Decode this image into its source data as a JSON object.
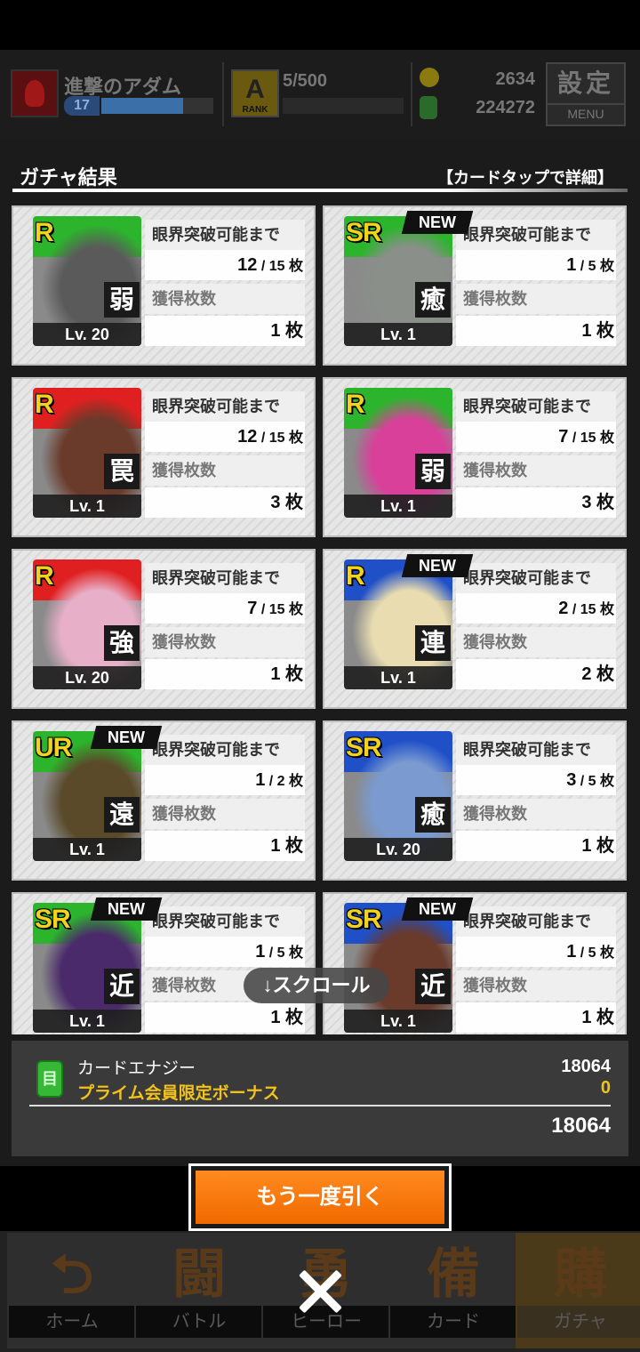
{
  "header": {
    "player_name": "進撃のアダム",
    "level": "17",
    "rank_letter": "A",
    "rank_label": "RANK",
    "stamina": "5/500",
    "coins": "2634",
    "energy": "224272",
    "menu_big": "設定",
    "menu_small": "MENU",
    "xp_fraction": 0.73
  },
  "panel": {
    "title": "ガチャ結果",
    "hint": "【カードタップで詳細】"
  },
  "labels": {
    "limit_break": "眼界突破可能まで",
    "obtained": "獲得枚数",
    "new": "NEW"
  },
  "cards": [
    {
      "rarity": "R",
      "role": "弱",
      "level": "Lv. 20",
      "progress": "12",
      "total": "/ 15 枚",
      "obtained": "1 枚",
      "new": false,
      "bg": "#2cb52c",
      "art": "#5a5a5a"
    },
    {
      "rarity": "SR",
      "role": "癒",
      "level": "Lv. 1",
      "progress": "1",
      "total": "/ 5 枚",
      "obtained": "1 枚",
      "new": true,
      "bg": "#2cb52c",
      "art": "#8a8f8a"
    },
    {
      "rarity": "R",
      "role": "罠",
      "level": "Lv. 1",
      "progress": "12",
      "total": "/ 15 枚",
      "obtained": "3 枚",
      "new": false,
      "bg": "#e02020",
      "art": "#6a3a2a"
    },
    {
      "rarity": "R",
      "role": "弱",
      "level": "Lv. 1",
      "progress": "7",
      "total": "/ 15 枚",
      "obtained": "3 枚",
      "new": false,
      "bg": "#2cb52c",
      "art": "#d8409a"
    },
    {
      "rarity": "R",
      "role": "強",
      "level": "Lv. 20",
      "progress": "7",
      "total": "/ 15 枚",
      "obtained": "1 枚",
      "new": false,
      "bg": "#e02020",
      "art": "#e8b0c8"
    },
    {
      "rarity": "R",
      "role": "連",
      "level": "Lv. 1",
      "progress": "2",
      "total": "/ 15 枚",
      "obtained": "2 枚",
      "new": true,
      "bg": "#2050c8",
      "art": "#e8dcb0"
    },
    {
      "rarity": "UR",
      "role": "遠",
      "level": "Lv. 1",
      "progress": "1",
      "total": "/ 2 枚",
      "obtained": "1 枚",
      "new": true,
      "bg": "#2cb52c",
      "art": "#5a4a2a"
    },
    {
      "rarity": "SR",
      "role": "癒",
      "level": "Lv. 20",
      "progress": "3",
      "total": "/ 5 枚",
      "obtained": "1 枚",
      "new": false,
      "bg": "#2050c8",
      "art": "#7a9ad0"
    },
    {
      "rarity": "SR",
      "role": "近",
      "level": "Lv. 1",
      "progress": "1",
      "total": "/ 5 枚",
      "obtained": "1 枚",
      "new": true,
      "bg": "#2cb52c",
      "art": "#4a2a6a"
    },
    {
      "rarity": "SR",
      "role": "近",
      "level": "Lv. 1",
      "progress": "1",
      "total": "/ 5 枚",
      "obtained": "1 枚",
      "new": true,
      "bg": "#2050c8",
      "art": "#6a3a2a"
    }
  ],
  "scroll_hint": "↓スクロール",
  "energy_summary": {
    "icon_glyph": "目",
    "label": "カードエナジー",
    "bonus_label": "プライム会員限定ボーナス",
    "value": "18064",
    "bonus_value": "0",
    "total": "18064"
  },
  "redraw_label": "もう一度引く",
  "nav": [
    {
      "label": "ホーム",
      "icon": "home-icon",
      "glyph": "⮌",
      "active": false
    },
    {
      "label": "バトル",
      "icon": "gamepad-icon",
      "glyph": "闘",
      "active": false
    },
    {
      "label": "ヒーロー",
      "icon": "hero-icon",
      "glyph": "勇",
      "active": false
    },
    {
      "label": "カード",
      "icon": "cards-icon",
      "glyph": "備",
      "active": false
    },
    {
      "label": "ガチャ",
      "icon": "gacha-icon",
      "glyph": "購",
      "active": true
    }
  ],
  "colors": {
    "accent_orange": "#f07a10",
    "bonus_yellow": "#f2c21a",
    "energy_green": "#36b736"
  }
}
